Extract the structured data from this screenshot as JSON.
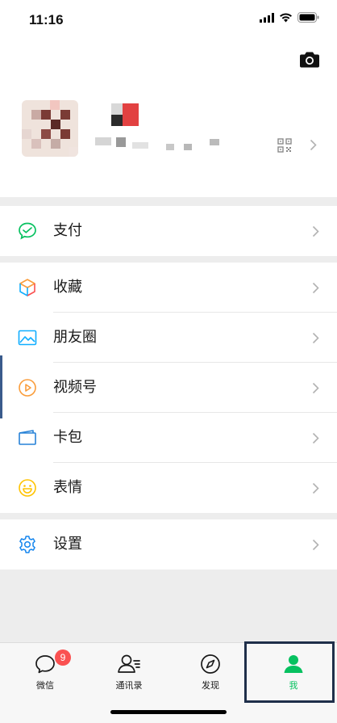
{
  "status_bar": {
    "time": "11:16"
  },
  "rows": {
    "pay": "支付",
    "favorites": "收藏",
    "moments": "朋友圈",
    "channels": "视频号",
    "cards": "卡包",
    "stickers": "表情",
    "settings": "设置"
  },
  "tabs": {
    "chats": "微信",
    "contacts": "通讯录",
    "discover": "发现",
    "me": "我",
    "chats_badge": "9",
    "active": "me"
  },
  "colors": {
    "accent_green": "#07c160",
    "badge_red": "#fa5151",
    "highlight_box": "#1f2f4a"
  },
  "icons": {
    "status": [
      "signal-icon",
      "wifi-icon",
      "battery-icon"
    ],
    "profile": [
      "camera-icon",
      "qr-code-icon",
      "chevron-right-icon"
    ],
    "rows": [
      "pay-icon",
      "favorites-icon",
      "moments-icon",
      "channels-icon",
      "card-wallet-icon",
      "sticker-icon",
      "settings-gear-icon"
    ],
    "tabs": [
      "chat-bubble-icon",
      "contacts-icon",
      "compass-icon",
      "person-icon"
    ]
  }
}
